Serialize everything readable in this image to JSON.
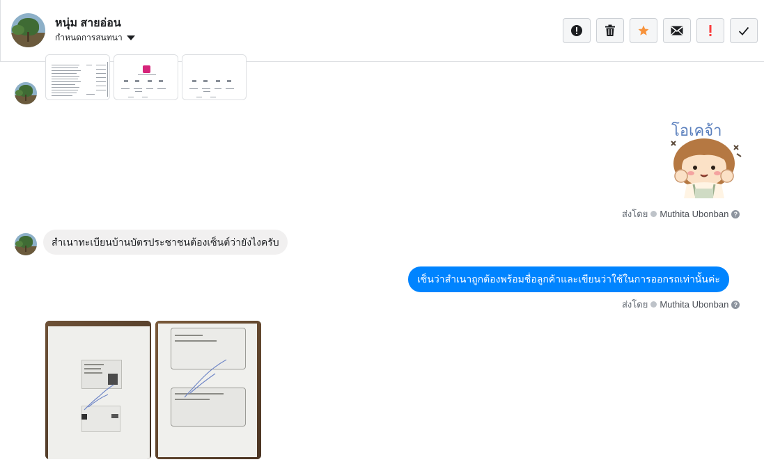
{
  "header": {
    "name": "หนุ่ม สายอ่อน",
    "subtitle": "กำหนดการสนทนา",
    "actions": [
      {
        "name": "report-icon"
      },
      {
        "name": "trash-icon"
      },
      {
        "name": "star-icon",
        "color": "#f7923b"
      },
      {
        "name": "envelope-icon"
      },
      {
        "name": "exclamation-icon",
        "color": "#fa3e3e"
      },
      {
        "name": "check-icon"
      }
    ]
  },
  "messages": {
    "sent_by_label": "ส่งโดย",
    "agent": "Muthita Ubonban",
    "sticker_text": "โอเคจ้า",
    "incoming_1": "สำเนาทะเบียนบ้านบัตรประชาชนต้องเซ็นต์ว่ายังไงครับ",
    "outgoing_1": "เซ็นว่าสำเนาถูกต้องพร้อมชื่อลูกค้าและเขียนว่าใช้ในการออกรถเท่านั้นค่ะ"
  },
  "colors": {
    "outgoing_bubble": "#0084ff",
    "incoming_bubble": "#f1f0f0"
  }
}
